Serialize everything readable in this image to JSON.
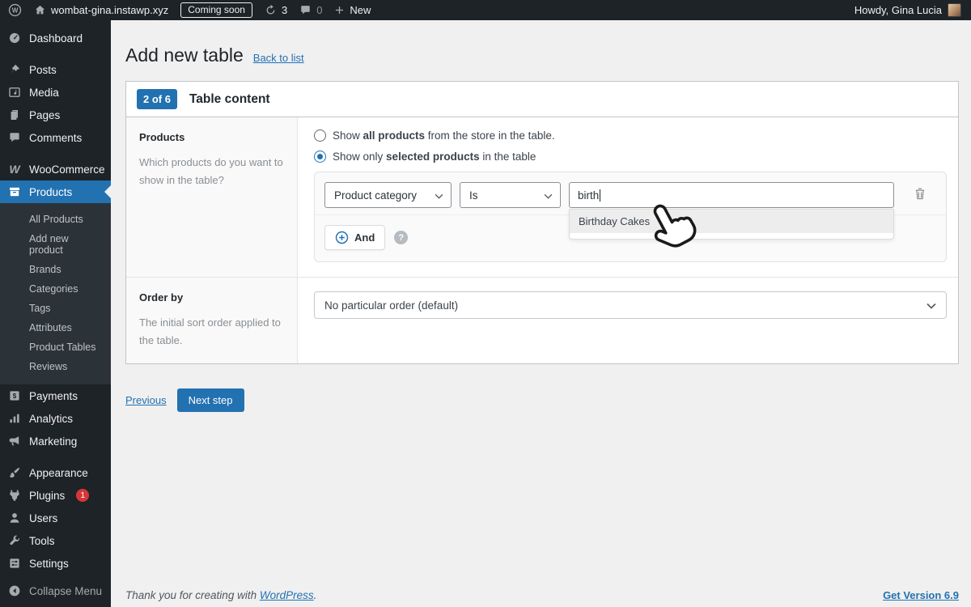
{
  "admin_bar": {
    "site_name": "wombat-gina.instawp.xyz",
    "coming_soon_label": "Coming soon",
    "updates_count": "3",
    "comments_count": "0",
    "new_label": "New",
    "howdy": "Howdy, Gina Lucia"
  },
  "sidebar": {
    "items": [
      {
        "label": "Dashboard"
      },
      {
        "label": "Posts"
      },
      {
        "label": "Media"
      },
      {
        "label": "Pages"
      },
      {
        "label": "Comments"
      },
      {
        "label": "WooCommerce"
      },
      {
        "label": "Products"
      }
    ],
    "products_submenu": [
      "All Products",
      "Add new product",
      "Brands",
      "Categories",
      "Tags",
      "Attributes",
      "Product Tables",
      "Reviews"
    ],
    "items_lower": [
      {
        "label": "Payments"
      },
      {
        "label": "Analytics"
      },
      {
        "label": "Marketing"
      },
      {
        "label": "Appearance"
      },
      {
        "label": "Plugins",
        "badge": "1"
      },
      {
        "label": "Users"
      },
      {
        "label": "Tools"
      },
      {
        "label": "Settings"
      }
    ],
    "collapse_label": "Collapse Menu"
  },
  "page": {
    "title": "Add new table",
    "back_link": "Back to list"
  },
  "wizard": {
    "step_badge": "2 of 6",
    "step_title": "Table content"
  },
  "form": {
    "products_row": {
      "label": "Products",
      "description": "Which products do you want to show in the table?",
      "radio_all": {
        "pre": "Show ",
        "bold": "all products",
        "post": " from the store in the table."
      },
      "radio_selected": {
        "pre": "Show only ",
        "bold": "selected products",
        "post": " in the table"
      },
      "filter": {
        "field_select": "Product category",
        "operator_select": "Is",
        "search_value": "birth",
        "suggestion": "Birthday Cakes",
        "and_label": "And",
        "help_label": "?"
      }
    },
    "order_row": {
      "label": "Order by",
      "description": "The initial sort order applied to the table.",
      "select_value": "No particular order (default)"
    }
  },
  "actions": {
    "previous_label": "Previous",
    "next_label": "Next step"
  },
  "footer": {
    "thanks_pre": "Thank you for creating with ",
    "wordpress_link": "WordPress",
    "thanks_post": ".",
    "version_link": "Get Version 6.9"
  },
  "colors": {
    "accent": "#2271b1",
    "admin_dark": "#1d2327",
    "notification": "#d63638"
  }
}
